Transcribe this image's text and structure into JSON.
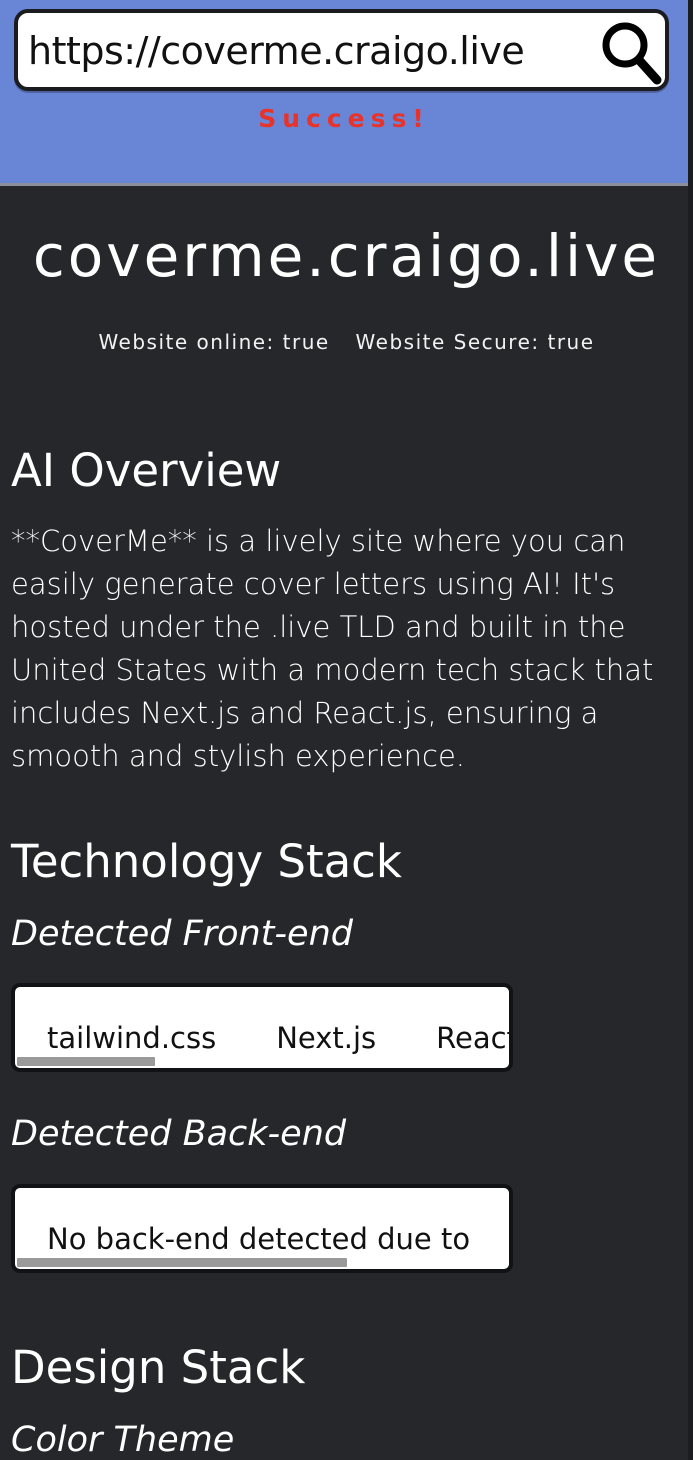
{
  "header": {
    "url_value": "https://coverme.craigo.live",
    "search_icon": "search-icon",
    "status": "Success!",
    "status_color": "#e8332a",
    "bar_color": "#6985d6"
  },
  "site": {
    "title": "coverme.craigo.live",
    "online": "Website online: true",
    "secure": "Website Secure: true"
  },
  "overview": {
    "heading": "AI Overview",
    "text": "**CoverMe** is a lively site where you can easily generate cover letters using AI! It's hosted under the .live TLD and built in the United States with a modern tech stack that includes Next.js and React.js, ensuring a smooth and stylish experience."
  },
  "tech": {
    "heading": "Technology Stack",
    "frontend_heading": "Detected Front-end",
    "frontend": [
      "tailwind.css",
      "Next.js",
      "React.js"
    ],
    "backend_heading": "Detected Back-end",
    "backend": [
      "No back-end detected due to"
    ]
  },
  "design": {
    "heading": "Design Stack",
    "color_theme_heading": "Color Theme"
  }
}
